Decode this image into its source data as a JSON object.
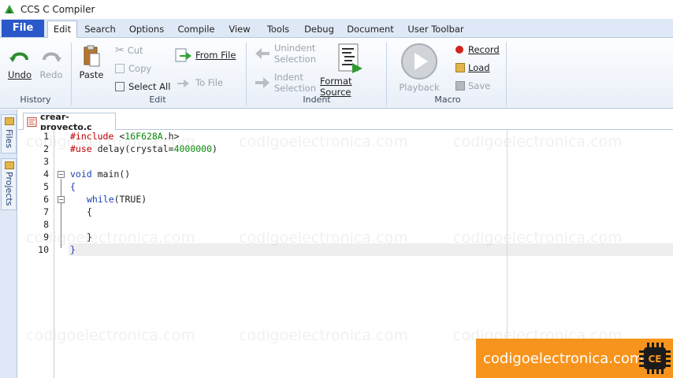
{
  "window": {
    "title": "CCS C Compiler"
  },
  "ribbon_tabs": [
    "File",
    "Edit",
    "Search",
    "Options",
    "Compile",
    "View",
    "Tools",
    "Debug",
    "Document",
    "User Toolbar"
  ],
  "active_tab": "Edit",
  "groups": {
    "history": {
      "label": "History",
      "undo": "Undo",
      "redo": "Redo"
    },
    "edit": {
      "label": "Edit",
      "paste": "Paste",
      "cut": "Cut",
      "copy": "Copy",
      "select_all": "Select All",
      "from_file": "From File",
      "to_file": "To File"
    },
    "indent": {
      "label": "Indent",
      "unindent_1": "Unindent",
      "unindent_2": "Selection",
      "indent_1": "Indent",
      "indent_2": "Selection",
      "format_source": "Format Source"
    },
    "macro": {
      "label": "Macro",
      "playback": "Playback",
      "record": "Record",
      "load": "Load",
      "save": "Save"
    }
  },
  "side_panel": {
    "files": "Files",
    "projects": "Projects"
  },
  "document_tab": {
    "filename": "crear-proyecto.c"
  },
  "editor": {
    "line_numbers": [
      "1",
      "2",
      "3",
      "4",
      "5",
      "6",
      "7",
      "8",
      "9",
      "10"
    ],
    "code": {
      "l1_kw": "#include",
      "l1_a": " <",
      "l1_num": "16F628A",
      "l1_b": ".h>",
      "l2_kw": "#use",
      "l2_a": " delay(crystal=",
      "l2_num": "4000000",
      "l2_b": ")",
      "l4_kw": "void",
      "l4_a": " main()",
      "l5": "{",
      "l6_kw": "while",
      "l6_a": "(TRUE)",
      "l7": "{",
      "l9": "}",
      "l10": "}"
    }
  },
  "watermark": "codigoelectronica.com",
  "brand": {
    "text": "codigoelectronica.com",
    "logo_text": "CE"
  }
}
